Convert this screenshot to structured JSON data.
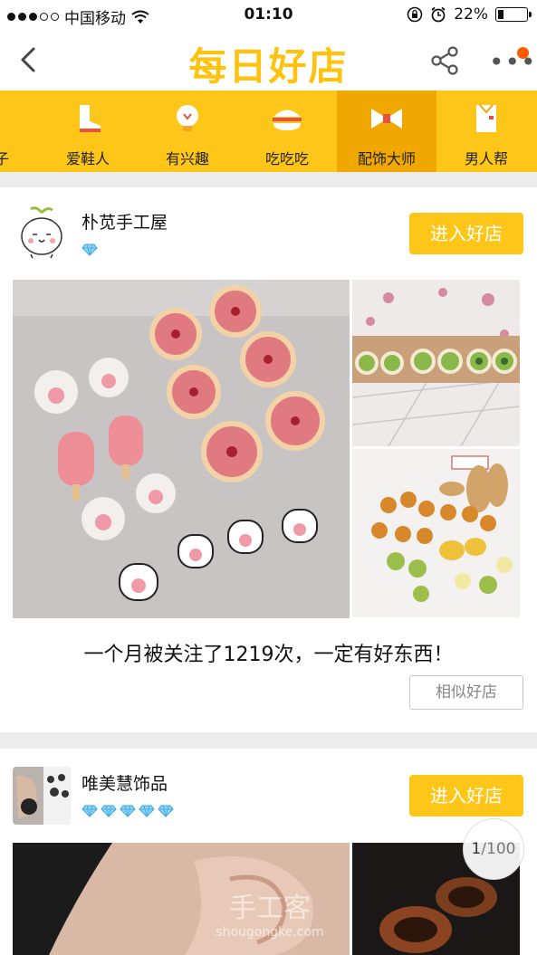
{
  "status": {
    "carrier": "中国移动",
    "time": "01:10",
    "battery": "22%",
    "battery_level": 0.22
  },
  "header": {
    "title": "每日好店"
  },
  "categories": [
    {
      "label": "子"
    },
    {
      "label": "爱鞋人"
    },
    {
      "label": "有兴趣"
    },
    {
      "label": "吃吃吃"
    },
    {
      "label": "配饰大师",
      "active": true
    },
    {
      "label": "男人帮"
    }
  ],
  "shops": [
    {
      "name": "朴苋手工屋",
      "diamond_count": 1,
      "enter_label": "进入好店",
      "tagline": "一个月被关注了1219次，一定有好东西！",
      "similar_label": "相似好店"
    },
    {
      "name": "唯美慧饰品",
      "diamond_count": 5,
      "enter_label": "进入好店"
    }
  ],
  "pager": {
    "current": "1",
    "total": "/100"
  },
  "watermark": {
    "main": "手工客",
    "url": "shougongke.com"
  },
  "colors": {
    "accent": "#ffc61a",
    "active_category": "#f0a700",
    "badge": "#ff5a00"
  }
}
